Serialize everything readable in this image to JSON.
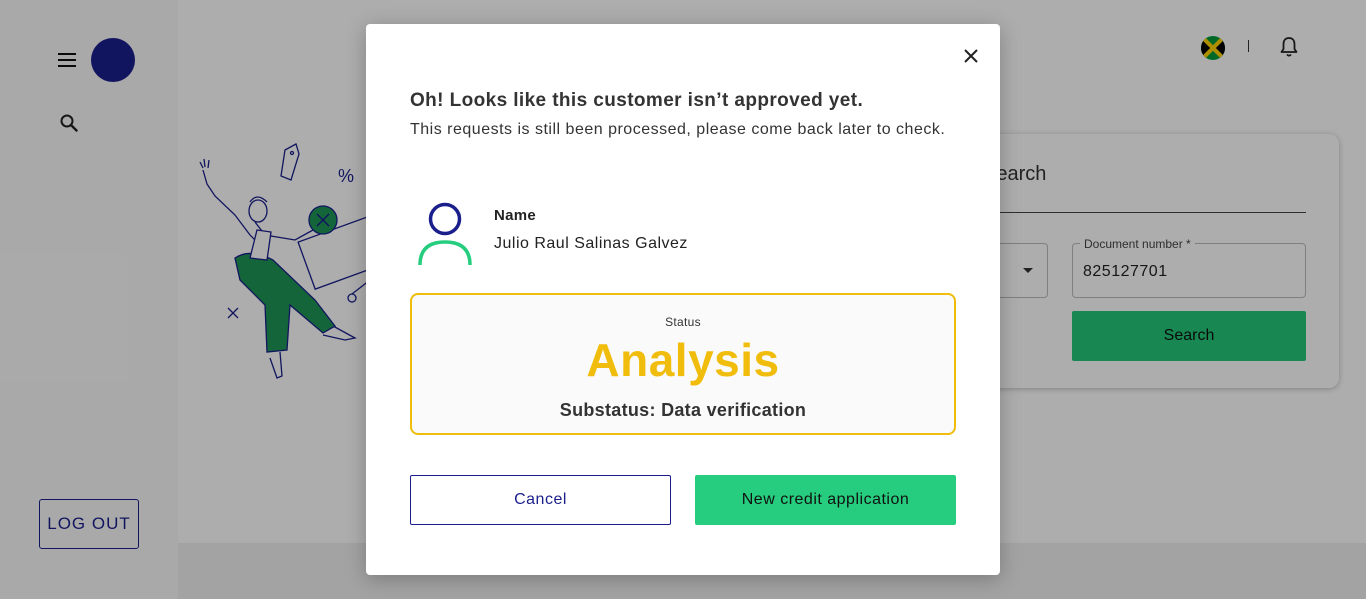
{
  "app": {
    "logout_label": "LOG OUT",
    "search_card": {
      "title": "Search",
      "document_label": "Document number *",
      "document_value": "825127701",
      "search_button": "Search"
    }
  },
  "modal": {
    "title": "Oh! Looks like this customer isn’t approved yet.",
    "subtitle": "This requests is still been processed, please come back later to check.",
    "name_label": "Name",
    "name_value": "Julio Raul Salinas Galvez",
    "status_label": "Status",
    "status_value": "Analysis",
    "substatus": "Substatus: Data verification",
    "cancel_label": "Cancel",
    "new_application_label": "New credit application"
  },
  "colors": {
    "brand_navy": "#1a1f8c",
    "brand_green": "#26cd7e",
    "status_yellow": "#f1bd0c"
  },
  "icons": [
    "menu-icon",
    "search-icon",
    "jamaica-flag-icon",
    "bell-icon",
    "close-icon",
    "person-icon"
  ]
}
